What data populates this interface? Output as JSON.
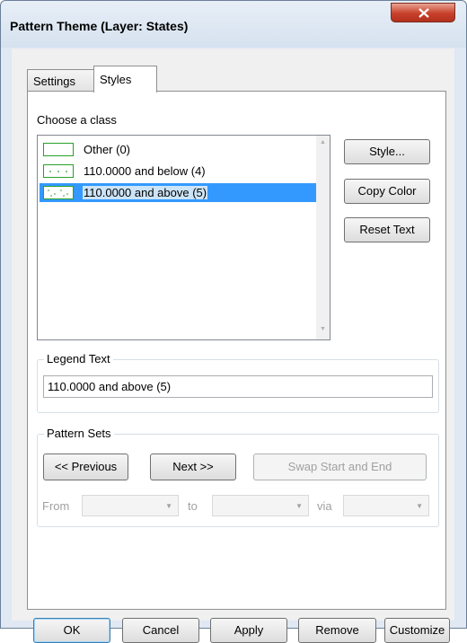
{
  "window": {
    "title": "Pattern Theme (Layer: States)",
    "close_glyph": "x"
  },
  "tabs": [
    {
      "label": "Settings"
    },
    {
      "label": "Styles"
    }
  ],
  "styles_tab": {
    "choose_label": "Choose a class",
    "classes": [
      {
        "label": "Other (0)",
        "swatch": "empty",
        "selected": false
      },
      {
        "label": "110.0000 and below (4)",
        "swatch": "dots-sparse",
        "selected": false
      },
      {
        "label": "110.0000 and above (5)",
        "swatch": "dots-dense",
        "selected": true
      }
    ],
    "side_buttons": {
      "style": "Style...",
      "copy_color": "Copy Color",
      "reset_text": "Reset Text"
    },
    "legend_text": {
      "group_label": "Legend Text",
      "value": "110.0000 and above (5)"
    },
    "pattern_sets": {
      "group_label": "Pattern Sets",
      "previous": "<< Previous",
      "next": "Next >>",
      "swap": "Swap Start and End",
      "from_label": "From",
      "to_label": "to",
      "via_label": "via"
    }
  },
  "footer": {
    "ok": "OK",
    "cancel": "Cancel",
    "apply": "Apply",
    "remove": "Remove",
    "customize": "Customize"
  },
  "colors": {
    "swatch_border": "#2aa02a",
    "selection": "#3399ff",
    "close_button": "#c7412b"
  }
}
